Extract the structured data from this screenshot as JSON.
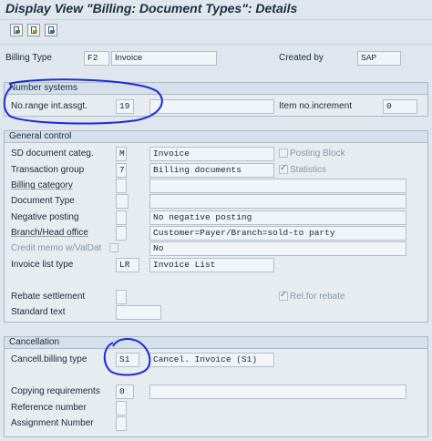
{
  "title": "Display View \"Billing: Document Types\": Details",
  "toolbar": {
    "icons": [
      "new-entries-icon",
      "copy-icon",
      "details-icon"
    ]
  },
  "header": {
    "billing_type_label": "Billing Type",
    "billing_type_code": "F2",
    "billing_type_desc": "Invoice",
    "created_by_label": "Created by",
    "created_by_value": "SAP"
  },
  "number_systems": {
    "title": "Number systems",
    "range_label": "No.range int.assgt.",
    "range_value": "19",
    "range_desc": "",
    "item_incr_label": "Item no.increment",
    "item_incr_value": "0"
  },
  "general_control": {
    "title": "General control",
    "sd_doc_categ_label": "SD document categ.",
    "sd_doc_categ_value": "M",
    "sd_doc_categ_desc": "Invoice",
    "posting_block_label": "Posting Block",
    "transaction_group_label": "Transaction group",
    "transaction_group_value": "7",
    "transaction_group_desc": "Billing documents",
    "statistics_label": "Statistics",
    "billing_category_label": "Billing category",
    "billing_category_value": "",
    "document_type_label": "Document Type",
    "document_type_value": "",
    "negative_posting_label": "Negative posting",
    "negative_posting_desc": "No negative posting",
    "branch_head_label": "Branch/Head office",
    "branch_head_desc": "Customer=Payer/Branch=sold-to party",
    "credit_memo_label": "Credit memo w/ValDat",
    "credit_memo_desc": "No",
    "invoice_list_type_label": "Invoice list type",
    "invoice_list_type_value": "LR",
    "invoice_list_type_desc": "Invoice List",
    "rebate_settlement_label": "Rebate settlement",
    "rel_for_rebate_label": "Rel.for rebate",
    "standard_text_label": "Standard text"
  },
  "cancellation": {
    "title": "Cancellation",
    "cancel_billing_type_label": "Cancell.billing type",
    "cancel_billing_type_value": "S1",
    "cancel_billing_type_desc": "Cancel. Invoice (S1)",
    "copying_req_label": "Copying requirements",
    "copying_req_value": "0",
    "reference_number_label": "Reference number",
    "assignment_number_label": "Assignment Number"
  },
  "annotation_color": "#1a2bd6"
}
